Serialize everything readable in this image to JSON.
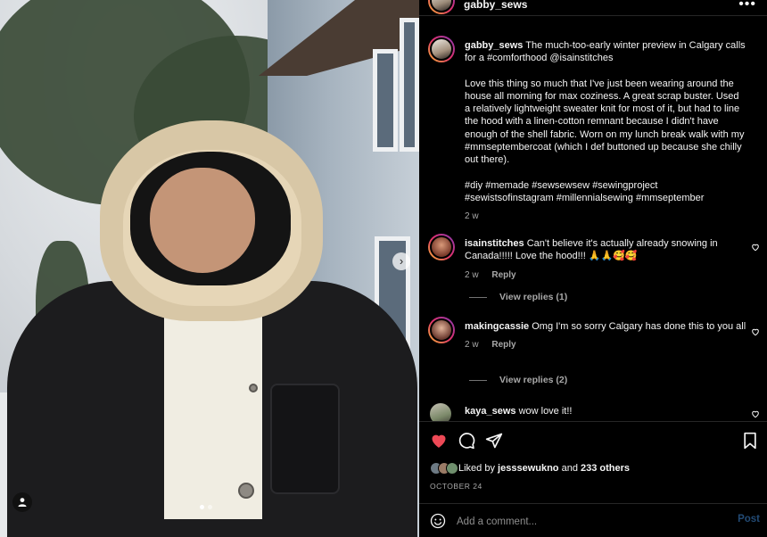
{
  "header": {
    "username": "gabby_sews",
    "more_icon": "more-horizontal-icon"
  },
  "caption": {
    "username": "gabby_sews",
    "line1": "The much-too-early winter preview in Calgary calls for a #comforthood @isainstitches",
    "line2": "Love this thing so much that I've just been wearing around the house all morning for max coziness. A great scrap buster. Used a relatively lightweight sweater knit for most of it, but had to line the hood with a linen-cotton remnant because I didn't have enough of the shell fabric. Worn on my lunch break walk with my #mmseptembercoat (which I def buttoned up because she chilly out there).",
    "hashtags": "#diy #memade #sewsewsew #sewingproject #sewistsofinstagram #millennialsewing #mmseptember",
    "time": "2 w"
  },
  "comments": [
    {
      "username": "isainstitches",
      "text": "Can't believe it's actually already snowing in Canada!!!!! Love the hood!!! 🙏🙏🥰🥰",
      "time": "2 w",
      "reply_label": "Reply",
      "view_replies": "View replies (1)"
    },
    {
      "username": "makingcassie",
      "text": "Omg I'm so sorry Calgary has done this to you all",
      "time": "2 w",
      "reply_label": "Reply",
      "view_replies": "View replies (2)"
    },
    {
      "username": "kaya_sews",
      "text": "wow love it!!"
    }
  ],
  "likes": {
    "prefix": "Liked by",
    "user": "jesssewukno",
    "middle": "and",
    "others": "233 others"
  },
  "date": "OCTOBER 24",
  "comment_input": {
    "placeholder": "Add a comment...",
    "post_label": "Post"
  },
  "colors": {
    "like_red": "#ed4956",
    "post_disabled_blue": "#224a74",
    "secondary_text": "#a8a8a8"
  },
  "carousel": {
    "slide_count": 2,
    "active_index": 0
  }
}
